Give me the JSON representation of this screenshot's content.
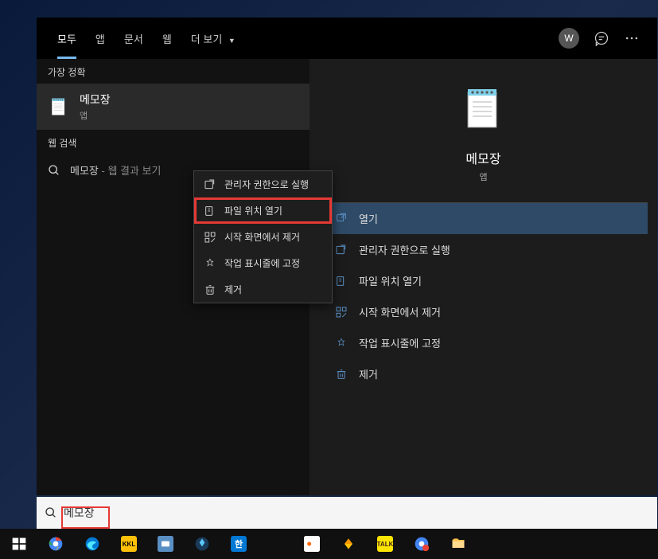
{
  "tabs": {
    "all": "모두",
    "apps": "앱",
    "documents": "문서",
    "web": "웹",
    "more": "더 보기"
  },
  "user": {
    "initial": "W"
  },
  "left": {
    "section_best": "가장 정확",
    "result_title": "메모장",
    "result_sub": "앱",
    "section_web": "웹 검색",
    "web_query": "메모장",
    "web_suffix": " - 웹 결과 보기"
  },
  "context_menu": {
    "run_admin": "관리자 권한으로 실행",
    "open_location": "파일 위치 열기",
    "unpin_start": "시작 화면에서 제거",
    "pin_taskbar": "작업 표시줄에 고정",
    "uninstall": "제거"
  },
  "preview": {
    "title": "메모장",
    "sub": "앱"
  },
  "actions": {
    "open": "열기",
    "run_admin": "관리자 권한으로 실행",
    "open_location": "파일 위치 열기",
    "unpin_start": "시작 화면에서 제거",
    "pin_taskbar": "작업 표시줄에 고정",
    "uninstall": "제거"
  },
  "search": {
    "value": "메모장"
  }
}
